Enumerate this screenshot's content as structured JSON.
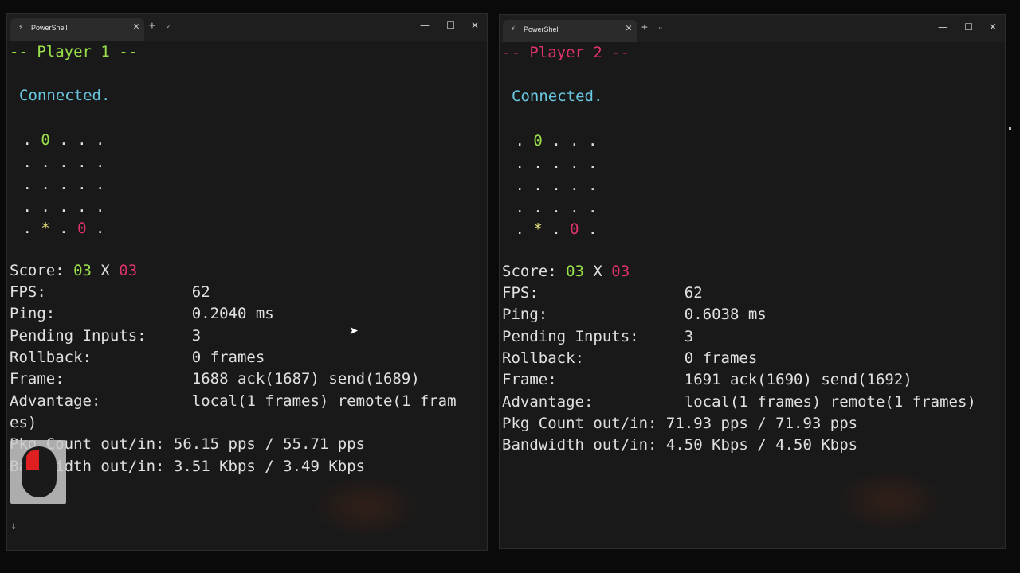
{
  "windows": [
    {
      "tab_title": "PowerShell",
      "new_tab": "+",
      "tab_menu": "⌄",
      "controls": {
        "minimize": "—",
        "maximize": "☐",
        "close": "✕"
      },
      "header": "-- Player 1 --",
      "status": "Connected.",
      "board": [
        [
          " . ",
          "0",
          " . . ."
        ],
        [
          " . . . . ."
        ],
        [
          " . . . . ."
        ],
        [
          " . . . . ."
        ],
        [
          " . ",
          "*",
          " . ",
          "0",
          " ."
        ]
      ],
      "score": {
        "label": "Score: ",
        "p1": "03",
        "sep": " X ",
        "p2": "03"
      },
      "stats": [
        "FPS:                62",
        "Ping:               0.2040 ms",
        "Pending Inputs:     3",
        "Rollback:           0 frames",
        "Frame:              1688 ack(1687) send(1689)",
        "Advantage:          local(1 frames) remote(1 fram",
        "es)",
        "Pkg Count out/in: 56.15 pps / 55.71 pps",
        "Bandwidth out/in: 3.51 Kbps / 3.49 Kbps"
      ],
      "scroll_indicator": "↓"
    },
    {
      "tab_title": "PowerShell",
      "new_tab": "+",
      "tab_menu": "⌄",
      "controls": {
        "minimize": "—",
        "maximize": "☐",
        "close": "✕"
      },
      "header": "-- Player 2 --",
      "status": "Connected.",
      "board": [
        [
          " . ",
          "0",
          " . . ."
        ],
        [
          " . . . . ."
        ],
        [
          " . . . . ."
        ],
        [
          " . . . . ."
        ],
        [
          " . ",
          "*",
          " . ",
          "0",
          " ."
        ]
      ],
      "score": {
        "label": "Score: ",
        "p1": "03",
        "sep": " X ",
        "p2": "03"
      },
      "stats": [
        "FPS:                62",
        "Ping:               0.6038 ms",
        "Pending Inputs:     3",
        "Rollback:           0 frames",
        "Frame:              1691 ack(1690) send(1692)",
        "Advantage:          local(1 frames) remote(1 frames)",
        "Pkg Count out/in: 71.93 pps / 71.93 pps",
        "Bandwidth out/in: 4.50 Kbps / 4.50 Kbps"
      ]
    }
  ],
  "colors": {
    "player1": "#9be04a",
    "player2": "#e0336e",
    "connected": "#69c7e0",
    "ball": "#e7e07a",
    "text": "#e0e0e0",
    "background": "#191919"
  },
  "icons": [
    "powershell-icon",
    "close-icon",
    "plus-icon",
    "chevron-down-icon",
    "minimize-icon",
    "maximize-icon",
    "mouse-icon",
    "cursor-icon"
  ]
}
